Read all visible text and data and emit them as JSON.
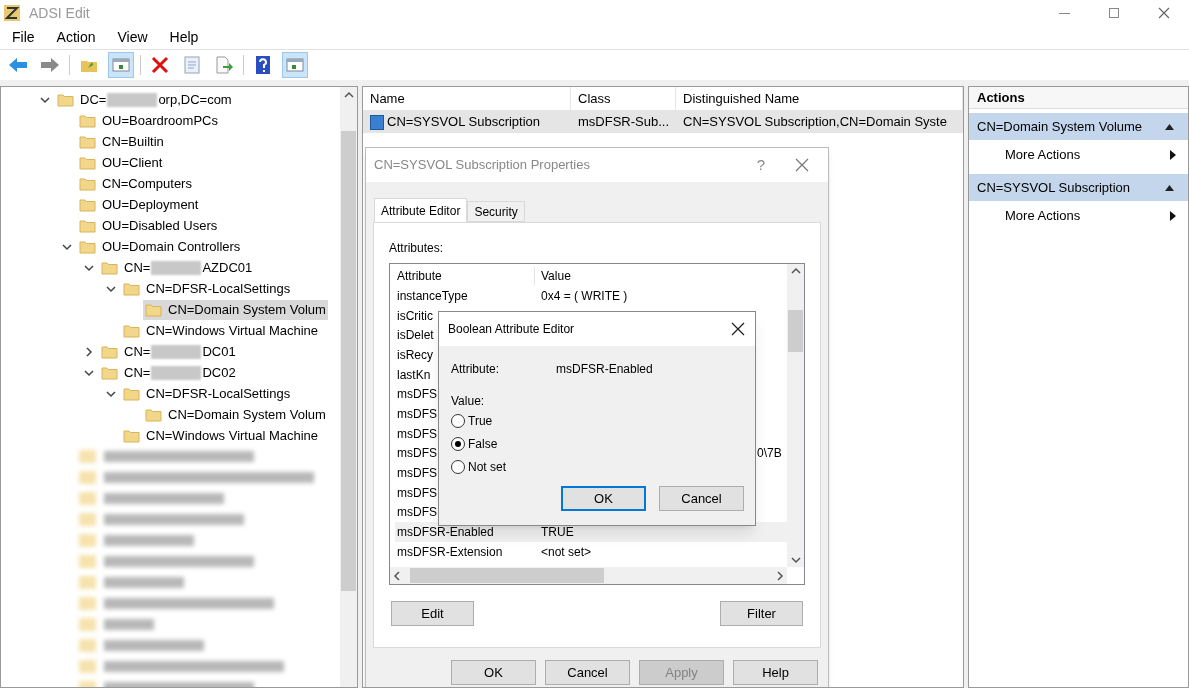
{
  "window": {
    "title": "ADSI Edit"
  },
  "menu": [
    "File",
    "Action",
    "View",
    "Help"
  ],
  "toolbar_groups": [
    [
      {
        "kind": "back",
        "selected": false
      },
      {
        "kind": "forward",
        "selected": false
      }
    ],
    [
      {
        "kind": "up",
        "selected": false
      },
      {
        "kind": "tree",
        "selected": true
      }
    ],
    [
      {
        "kind": "delete",
        "selected": false
      },
      {
        "kind": "props",
        "selected": false
      },
      {
        "kind": "export",
        "selected": false
      }
    ],
    [
      {
        "kind": "help",
        "selected": false
      },
      {
        "kind": "pane",
        "selected": true
      }
    ]
  ],
  "tree": [
    {
      "label_parts": [
        "DC=",
        "orp,DC=com"
      ],
      "expanded": true,
      "selected": false,
      "children": [
        {
          "label": "OU=BoardroomPCs",
          "selected": false
        },
        {
          "label": "CN=Builtin",
          "selected": false
        },
        {
          "label": "OU=Client",
          "selected": false
        },
        {
          "label": "CN=Computers",
          "selected": false
        },
        {
          "label": "OU=Deployment",
          "selected": false
        },
        {
          "label": "OU=Disabled Users",
          "selected": false
        },
        {
          "label": "OU=Domain Controllers",
          "expanded": true,
          "selected": false,
          "children": [
            {
              "label_parts": [
                "CN=",
                "AZDC01"
              ],
              "expanded": true,
              "selected": false,
              "children": [
                {
                  "label": "CN=DFSR-LocalSettings",
                  "expanded": true,
                  "selected": false,
                  "children": [
                    {
                      "label": "CN=Domain System Volum",
                      "selected": true
                    }
                  ]
                },
                {
                  "label": "CN=Windows Virtual Machine",
                  "selected": false
                }
              ]
            },
            {
              "label_parts": [
                "CN=",
                "DC01"
              ],
              "expanded": false,
              "selected": false
            },
            {
              "label_parts": [
                "CN=",
                "DC02"
              ],
              "expanded": true,
              "selected": false,
              "children": [
                {
                  "label": "CN=DFSR-LocalSettings",
                  "expanded": true,
                  "selected": false,
                  "children": [
                    {
                      "label": "CN=Domain System Volum",
                      "selected": false
                    }
                  ]
                },
                {
                  "label": "CN=Windows Virtual Machine",
                  "selected": false
                }
              ]
            }
          ]
        }
      ]
    }
  ],
  "list": {
    "columns": [
      "Name",
      "Class",
      "Distinguished Name"
    ],
    "rows": [
      {
        "selected": true,
        "cells": [
          "CN=SYSVOL Subscription",
          "msDFSR-Sub...",
          "CN=SYSVOL Subscription,CN=Domain Syste"
        ]
      }
    ]
  },
  "properties": {
    "title": "CN=SYSVOL Subscription Properties",
    "help": "?",
    "tabs": [
      {
        "label": "Attribute Editor",
        "selected": true
      },
      {
        "label": "Security",
        "selected": false
      }
    ],
    "attributes_label": "Attributes:",
    "columns": [
      "Attribute",
      "Value"
    ],
    "rows": [
      {
        "name": "instanceType",
        "value": "0x4 = ( WRITE )",
        "selected": false
      },
      {
        "name": "isCritic",
        "selected": false
      },
      {
        "name": "isDelet",
        "selected": false
      },
      {
        "name": "isRecy",
        "selected": false
      },
      {
        "name": "lastKn",
        "selected": false
      },
      {
        "name": "msDFS",
        "selected": false
      },
      {
        "name": "msDFS",
        "selected": false
      },
      {
        "name": "msDFS",
        "selected": false
      },
      {
        "name": "msDFS",
        "value_tail": "0\\7B",
        "selected": false
      },
      {
        "name": "msDFS",
        "selected": false
      },
      {
        "name": "msDFS",
        "selected": false
      },
      {
        "name": "msDFS",
        "selected": false
      },
      {
        "name": "msDFSR-Enabled",
        "value": "TRUE",
        "selected": true
      },
      {
        "name": "msDFSR-Extension",
        "value": "<not set>",
        "selected": false
      }
    ],
    "edit_button": "Edit",
    "filter_button": "Filter",
    "buttons": [
      {
        "label": "OK",
        "disabled": false
      },
      {
        "label": "Cancel",
        "disabled": false
      },
      {
        "label": "Apply",
        "disabled": true
      },
      {
        "label": "Help",
        "disabled": false
      }
    ]
  },
  "boolean_editor": {
    "title": "Boolean Attribute Editor",
    "attribute_label": "Attribute:",
    "attribute_value": "msDFSR-Enabled",
    "value_label": "Value:",
    "options": [
      {
        "label": "True",
        "selected": false
      },
      {
        "label": "False",
        "selected": true
      },
      {
        "label": "Not set",
        "selected": false
      }
    ],
    "buttons": [
      {
        "label": "OK",
        "default": true
      },
      {
        "label": "Cancel",
        "default": false
      }
    ]
  },
  "actions": {
    "title": "Actions",
    "sections": [
      {
        "title": "CN=Domain System Volume",
        "items": [
          "More Actions"
        ]
      },
      {
        "title": "CN=SYSVOL Subscription",
        "items": [
          "More Actions"
        ]
      }
    ]
  }
}
